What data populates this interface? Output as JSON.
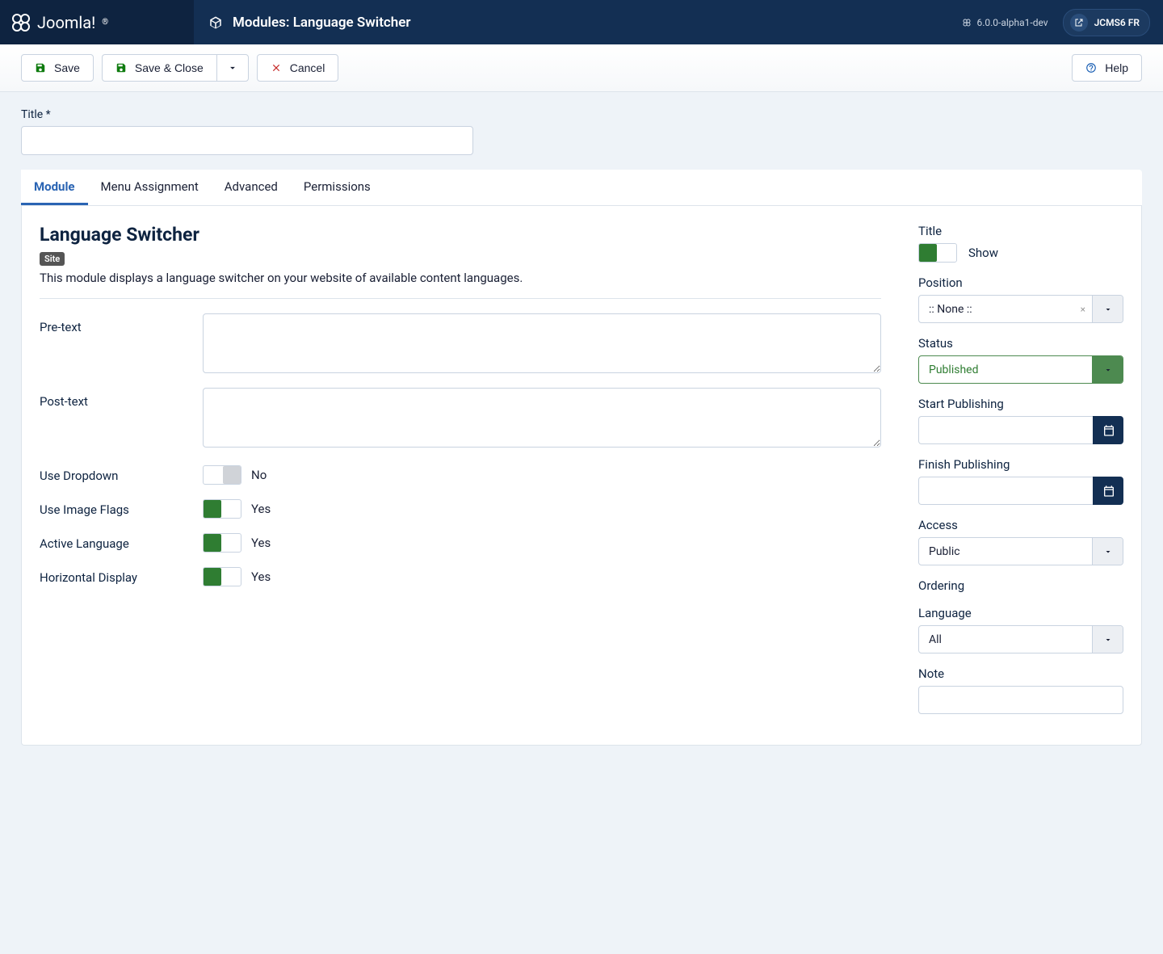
{
  "topbar": {
    "brand": "Joomla!",
    "page_title": "Modules: Language Switcher",
    "version": "6.0.0-alpha1-dev",
    "site_name": "JCMS6 FR"
  },
  "toolbar": {
    "save": "Save",
    "save_close": "Save & Close",
    "cancel": "Cancel",
    "help": "Help"
  },
  "title_field": {
    "label": "Title *",
    "value": ""
  },
  "tabs": [
    {
      "label": "Module",
      "active": true
    },
    {
      "label": "Menu Assignment",
      "active": false
    },
    {
      "label": "Advanced",
      "active": false
    },
    {
      "label": "Permissions",
      "active": false
    }
  ],
  "module": {
    "heading": "Language Switcher",
    "badge": "Site",
    "description": "This module displays a language switcher on your website of available content languages.",
    "fields": {
      "pre_text": {
        "label": "Pre-text",
        "value": ""
      },
      "post_text": {
        "label": "Post-text",
        "value": ""
      },
      "use_dropdown": {
        "label": "Use Dropdown",
        "value": "No",
        "on": false
      },
      "use_image_flags": {
        "label": "Use Image Flags",
        "value": "Yes",
        "on": true
      },
      "active_language": {
        "label": "Active Language",
        "value": "Yes",
        "on": true
      },
      "horizontal_display": {
        "label": "Horizontal Display",
        "value": "Yes",
        "on": true
      }
    }
  },
  "sidebar": {
    "title": {
      "label": "Title",
      "value": "Show",
      "on": true
    },
    "position": {
      "label": "Position",
      "value": ":: None ::"
    },
    "status": {
      "label": "Status",
      "value": "Published"
    },
    "start_publishing": {
      "label": "Start Publishing",
      "value": ""
    },
    "finish_publishing": {
      "label": "Finish Publishing",
      "value": ""
    },
    "access": {
      "label": "Access",
      "value": "Public"
    },
    "ordering": {
      "label": "Ordering"
    },
    "language": {
      "label": "Language",
      "value": "All"
    },
    "note": {
      "label": "Note",
      "value": ""
    }
  }
}
